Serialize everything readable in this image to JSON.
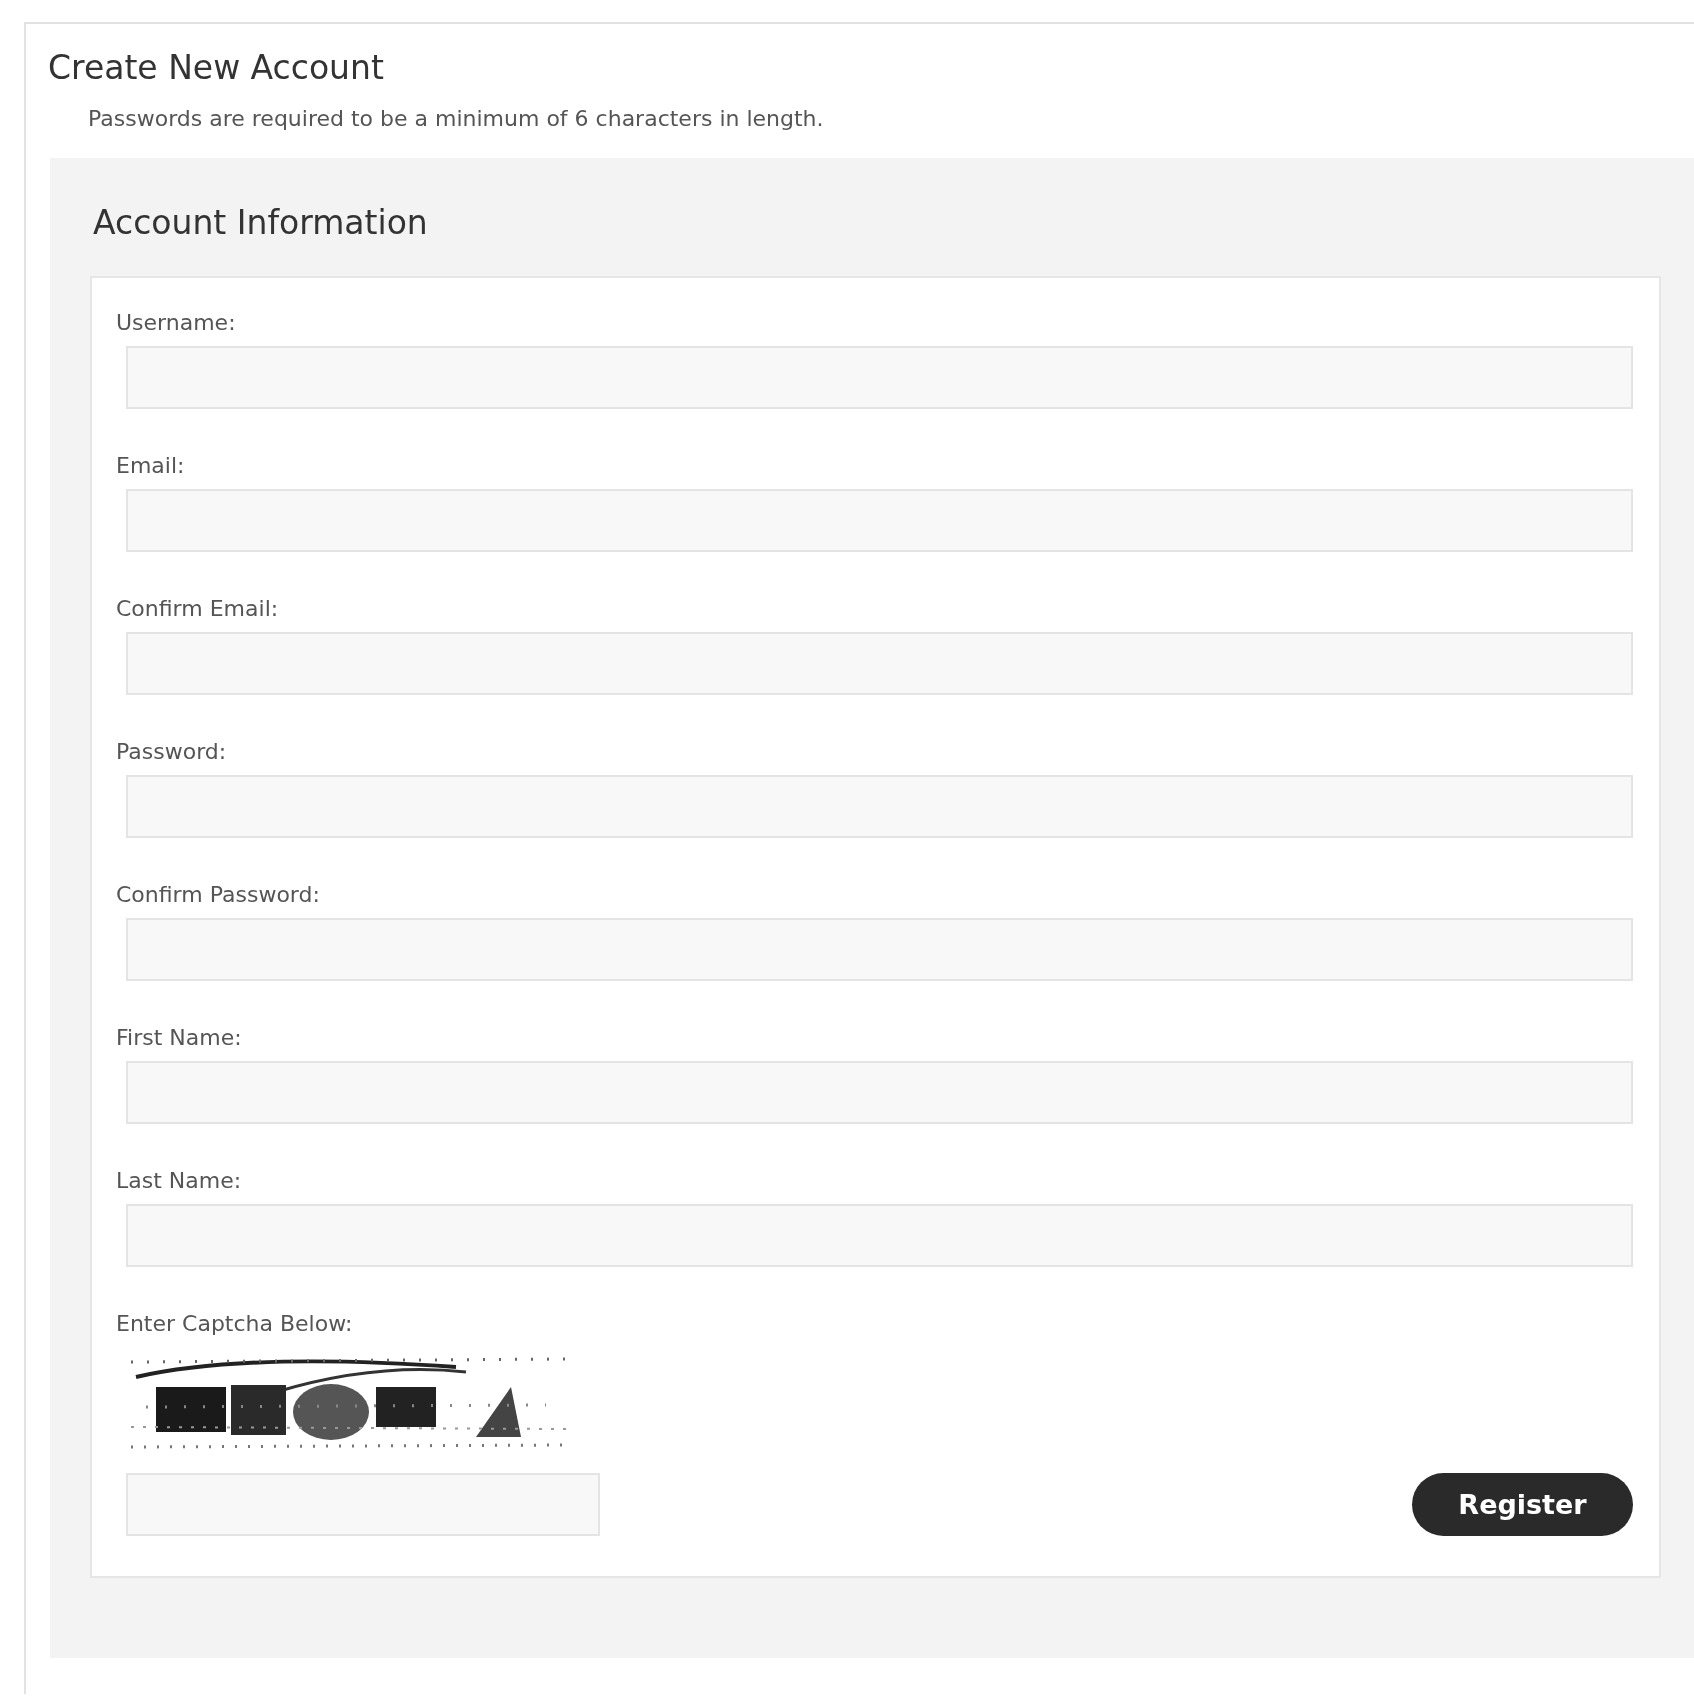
{
  "page": {
    "title": "Create New Account",
    "note": "Passwords are required to be a minimum of 6 characters in length."
  },
  "section": {
    "title": "Account Information"
  },
  "fields": [
    {
      "label": "Username:"
    },
    {
      "label": "Email:"
    },
    {
      "label": "Confirm Email:"
    },
    {
      "label": "Password:"
    },
    {
      "label": "Confirm Password:"
    },
    {
      "label": "First Name:"
    },
    {
      "label": "Last Name:"
    }
  ],
  "captcha": {
    "label": "Enter Captcha Below:"
  },
  "register_button": "Register"
}
